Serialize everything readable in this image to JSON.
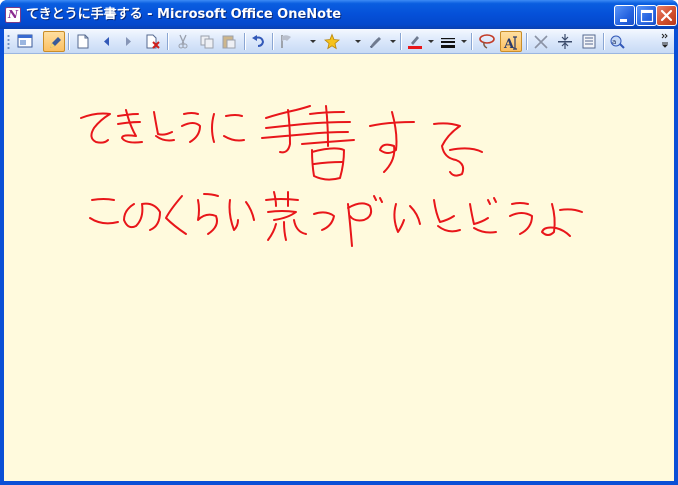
{
  "window": {
    "title": "てきとうに手書する - Microsoft Office OneNote",
    "app_icon": "onenote-icon",
    "app_icon_glyph": "N"
  },
  "caption_buttons": [
    {
      "name": "minimize-button",
      "icon": "minimize-icon"
    },
    {
      "name": "maximize-button",
      "icon": "maximize-icon"
    },
    {
      "name": "close-button",
      "icon": "close-icon"
    }
  ],
  "toolbar": {
    "items": [
      "full-page-view-icon",
      "pen-mode-icon",
      "new-page-icon",
      "back-icon",
      "forward-icon",
      "delete-page-icon",
      "cut-icon",
      "copy-icon",
      "paste-icon",
      "undo-icon",
      "flag-icon",
      "star-tag-icon",
      "pen-icon",
      "font-color-icon",
      "line-style-icon",
      "lasso-select-icon",
      "text-pen-toggle-icon",
      "eraser-icon",
      "insert-space-icon",
      "page-icon",
      "research-icon"
    ],
    "active_items": [
      "pen-mode-icon",
      "text-pen-toggle-icon"
    ]
  },
  "canvas": {
    "background": "#fffadd",
    "ink_color": "#e8161a",
    "handwriting_lines": [
      "てきとうに手書する",
      "このくらい荒っぽいとどうよ"
    ]
  }
}
